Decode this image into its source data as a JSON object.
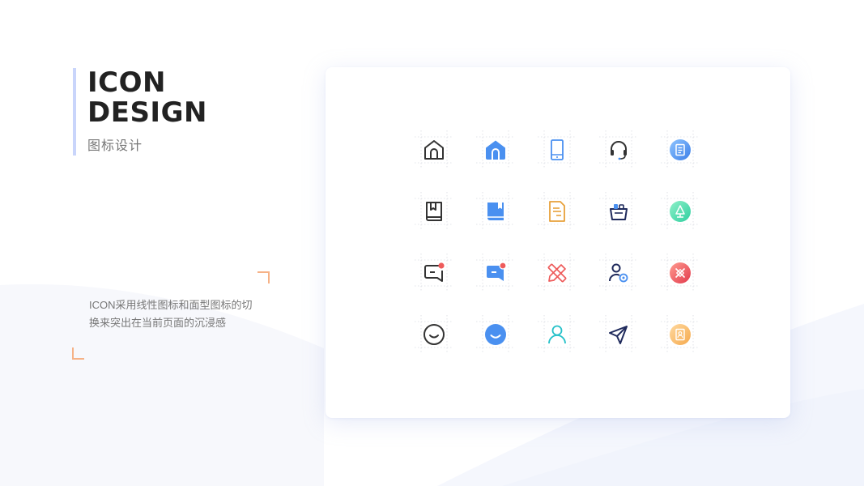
{
  "title": {
    "line1": "ICON",
    "line2": "DESIGN",
    "subtitle": "图标设计"
  },
  "description": {
    "line1": "ICON采用线性图标和面型图标的切",
    "line2": "换来突出在当前页面的沉浸感"
  },
  "colors": {
    "accent_bar": "#c9d5fb",
    "corner_marks": "#f6b287",
    "primary_blue": "#4a90f0",
    "line_dark": "#333333",
    "red": "#ee5b5b",
    "orange": "#e8a13a",
    "teal": "#26c1c9",
    "navy": "#1f2a5c"
  },
  "icons": [
    {
      "name": "home-outline-icon"
    },
    {
      "name": "home-filled-icon"
    },
    {
      "name": "tablet-icon"
    },
    {
      "name": "headset-icon"
    },
    {
      "name": "document-circle-icon"
    },
    {
      "name": "book-outline-icon"
    },
    {
      "name": "book-filled-icon"
    },
    {
      "name": "document-icon"
    },
    {
      "name": "basket-icon"
    },
    {
      "name": "tree-circle-icon"
    },
    {
      "name": "message-outline-icon"
    },
    {
      "name": "message-filled-icon"
    },
    {
      "name": "pencil-ruler-icon"
    },
    {
      "name": "user-settings-icon"
    },
    {
      "name": "pencil-ruler-circle-icon"
    },
    {
      "name": "smile-outline-icon"
    },
    {
      "name": "smile-filled-icon"
    },
    {
      "name": "user-icon"
    },
    {
      "name": "send-icon"
    },
    {
      "name": "contact-circle-icon"
    }
  ]
}
